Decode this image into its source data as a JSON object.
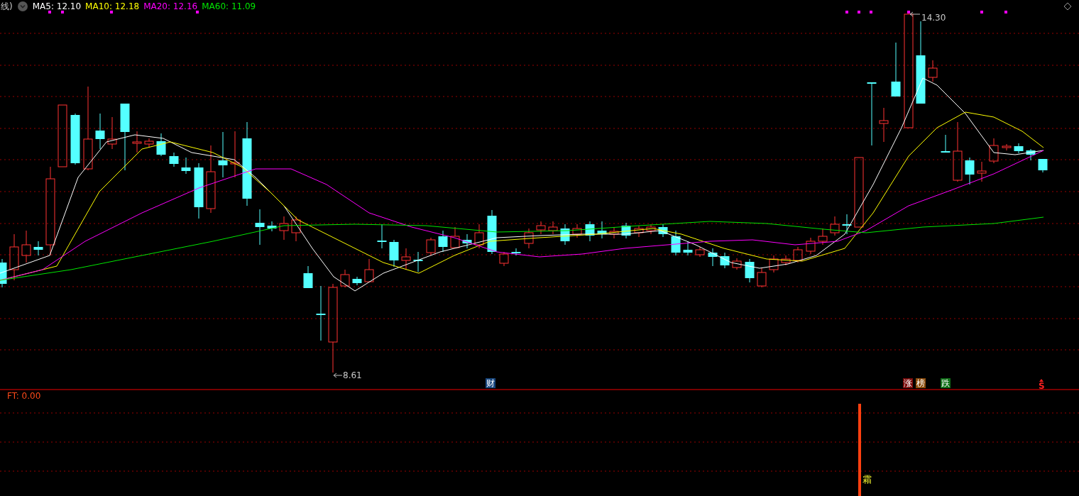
{
  "main_panel": {
    "cut_label": "线)",
    "legend": [
      {
        "label": "MA5: 12.10",
        "color": "#ffffff"
      },
      {
        "label": "MA10: 12.18",
        "color": "#ffff00"
      },
      {
        "label": "MA20: 12.16",
        "color": "#ff00ff"
      },
      {
        "label": "MA60: 11.09",
        "color": "#00e600"
      }
    ],
    "high_label": "14.30",
    "low_label": "8.61",
    "events": [
      {
        "kind": "badge",
        "label": "财",
        "color": "#17467e"
      },
      {
        "kind": "badge",
        "label": "涨",
        "color": "#7a0b0b"
      },
      {
        "kind": "badge",
        "label": "榜",
        "color": "#8a4a0a"
      },
      {
        "kind": "badge",
        "label": "跌",
        "color": "#0f6e17"
      },
      {
        "kind": "signal",
        "label": "S",
        "color": "#ff2020"
      }
    ]
  },
  "indicator_panel": {
    "legend": "FT: 0.00",
    "signal_label": "霜"
  }
}
